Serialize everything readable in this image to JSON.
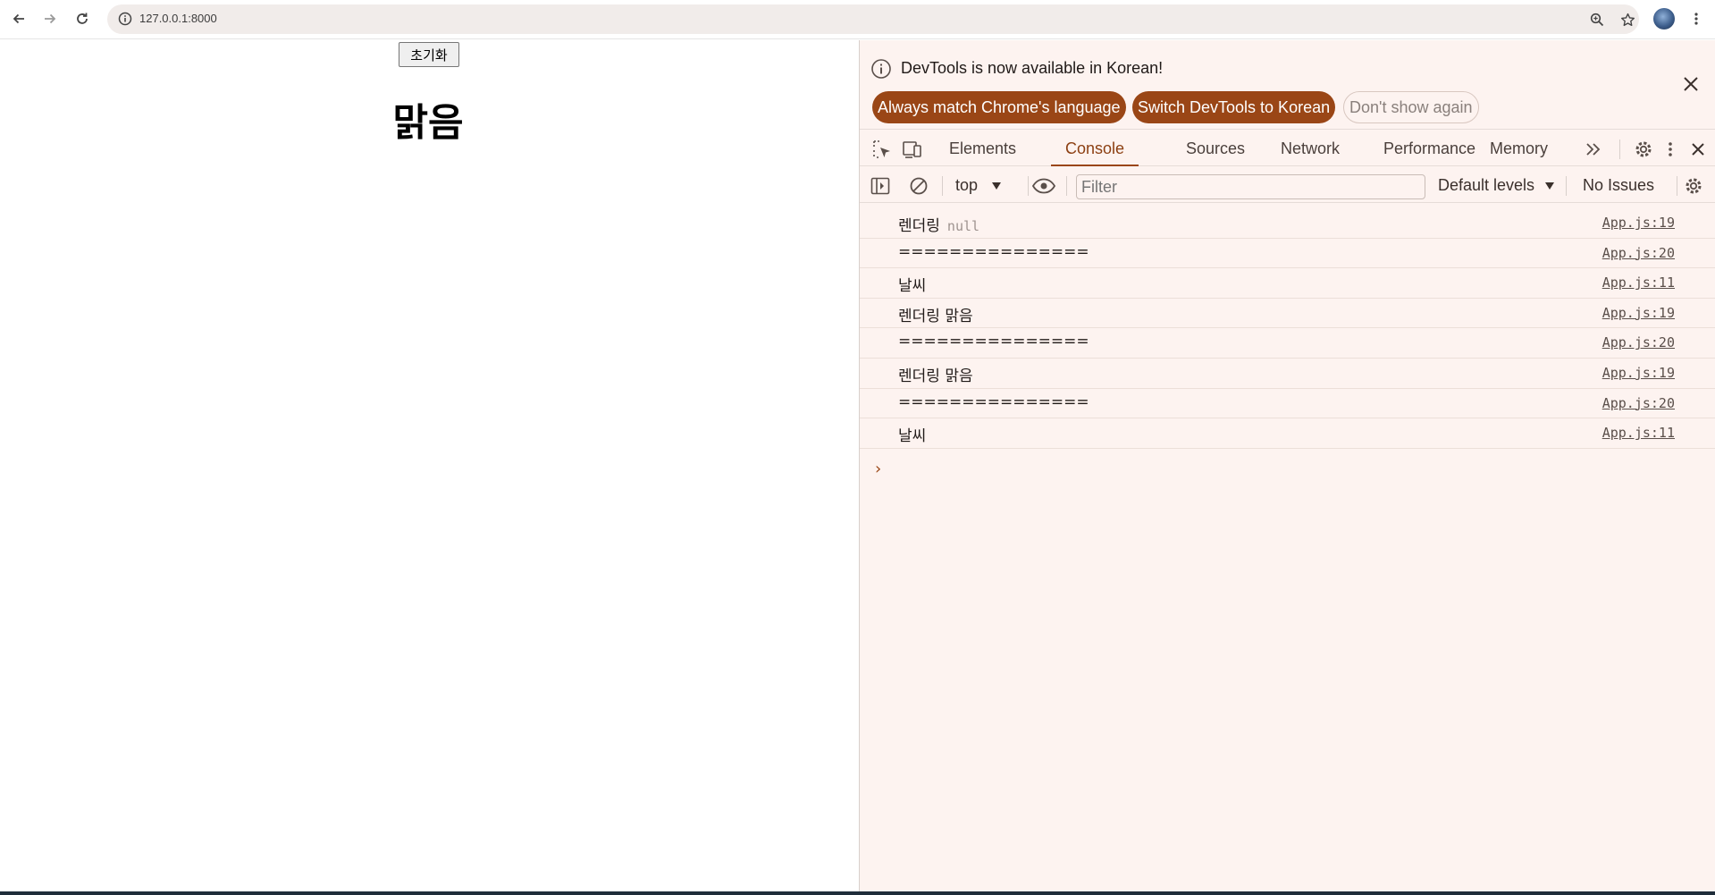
{
  "browser": {
    "url": "127.0.0.1:8000"
  },
  "page": {
    "reset_button": "초기화",
    "weather_text": "맑음"
  },
  "devtools": {
    "infobar": {
      "message": "DevTools is now available in Korean!",
      "always_match": "Always match Chrome's language",
      "switch_lang": "Switch DevTools to Korean",
      "dont_show": "Don't show again"
    },
    "tabs": [
      {
        "label": "Elements",
        "active": false
      },
      {
        "label": "Console",
        "active": true
      },
      {
        "label": "Sources",
        "active": false
      },
      {
        "label": "Network",
        "active": false
      },
      {
        "label": "Performance",
        "active": false
      },
      {
        "label": "Memory",
        "active": false
      }
    ],
    "filterbar": {
      "context": "top",
      "filter_placeholder": "Filter",
      "levels": "Default levels",
      "issues": "No Issues"
    },
    "console_rows": [
      {
        "text": "렌더링",
        "extra": "null",
        "source": "App.js:19"
      },
      {
        "text": "===============",
        "extra": "",
        "source": "App.js:20"
      },
      {
        "text": "날씨",
        "extra": "",
        "source": "App.js:11"
      },
      {
        "text": "렌더링 맑음",
        "extra": "",
        "source": "App.js:19"
      },
      {
        "text": "===============",
        "extra": "",
        "source": "App.js:20"
      },
      {
        "text": "렌더링 맑음",
        "extra": "",
        "source": "App.js:19"
      },
      {
        "text": "===============",
        "extra": "",
        "source": "App.js:20"
      },
      {
        "text": "날씨",
        "extra": "",
        "source": "App.js:11"
      }
    ],
    "prompt_glyph": "›"
  },
  "colors": {
    "accent": "#9a4616",
    "devtools_bg": "#fdf3f0",
    "omnibox_bg": "#f1ecea"
  }
}
